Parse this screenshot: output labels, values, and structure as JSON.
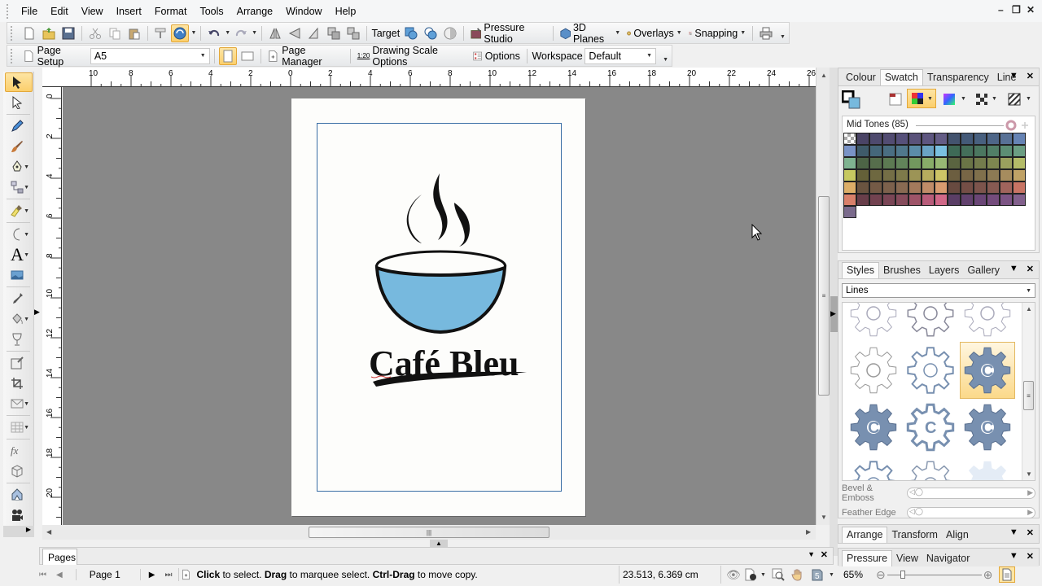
{
  "menubar": {
    "items": [
      "File",
      "Edit",
      "View",
      "Insert",
      "Format",
      "Tools",
      "Arrange",
      "Window",
      "Help"
    ],
    "window_controls": {
      "minimize": "–",
      "restore": "❐",
      "close": "✕"
    }
  },
  "toolbar1": {
    "target_label": "Target",
    "pressure_studio_label": "Pressure Studio",
    "planes_label": "3D Planes",
    "overlays_label": "Overlays",
    "snapping_label": "Snapping",
    "icons": [
      "new-icon",
      "open-icon",
      "save-icon",
      "cut-icon",
      "copy-icon",
      "paste-icon",
      "format-painter-icon",
      "globe-icon",
      "undo-icon",
      "redo-icon",
      "flip-horizontal-icon",
      "flip-vertical-icon",
      "rotate-icon",
      "group-icon",
      "ungroup-icon",
      "target-add-icon",
      "target-intersect-icon",
      "target-subtract-icon",
      "pressure-studio-icon",
      "3d-planes-icon",
      "overlays-icon",
      "snapping-icon",
      "print-icon"
    ]
  },
  "toolbar2": {
    "page_setup_label": "Page Setup",
    "page_size_value": "A5",
    "page_manager_label": "Page Manager",
    "drawing_scale_badge": "1:20",
    "drawing_scale_label": "Drawing Scale Options",
    "options_label": "Options",
    "workspace_label": "Workspace",
    "workspace_value": "Default"
  },
  "rulers": {
    "unit": "cm",
    "horizontal_ticks": [
      "10",
      "8",
      "6",
      "4",
      "2",
      "0",
      "2",
      "4",
      "6",
      "8",
      "10",
      "12",
      "14",
      "16",
      "18",
      "20",
      "22",
      "24",
      "26"
    ],
    "vertical_ticks": [
      "0",
      "2",
      "4",
      "6",
      "8",
      "10",
      "12",
      "14",
      "16",
      "18",
      "20"
    ]
  },
  "document": {
    "logo_text": "Café Bleu",
    "bowl_color": "#77b9de"
  },
  "pages_panel": {
    "tab_label": "Pages"
  },
  "statusbar": {
    "page_label": "Page 1",
    "hint_bold_1": "Click",
    "hint_1": " to select. ",
    "hint_bold_2": "Drag",
    "hint_2": " to marquee select. ",
    "hint_bold_3": "Ctrl-Drag",
    "hint_3": " to move copy.",
    "coordinates": "23.513,  6.369 cm",
    "zoom_value": "65%",
    "zoom_fraction": 0.15
  },
  "colour_panel": {
    "tabs": [
      "Colour",
      "Swatch",
      "Transparency",
      "Line"
    ],
    "selected_tab": "Swatch",
    "palette_title": "Mid Tones (85)",
    "swatch_rows": [
      [
        "checker",
        "#4a4466",
        "#4e4a6e",
        "#524c72",
        "#56507a",
        "#5a527a",
        "#5e5680",
        "#645d86",
        "#43536e",
        "#445a78",
        "#48607f",
        "#4e6688",
        "#587196",
        "#6683b4"
      ],
      [
        "#7a93c6",
        "#3f5b6a",
        "#45677a",
        "#4a6e82",
        "#50788c",
        "#5b8ca8",
        "#6aa3c4",
        "#7ac0e0",
        "#3e6a56",
        "#446f5a",
        "#4b7760",
        "#517f67",
        "#5c8e74",
        "#6b9e83"
      ],
      [
        "#7fb390",
        "#4d6446",
        "#566e4c",
        "#5c7a52",
        "#62845a",
        "#72985e",
        "#88ac68",
        "#98b874",
        "#5a6440",
        "#6a7446",
        "#747c4c",
        "#7e8750",
        "#9aa05e",
        "#b4bc68"
      ],
      [
        "#c6c860",
        "#646038",
        "#6e6840",
        "#746e46",
        "#7e7a4a",
        "#9c9456",
        "#b6ac5e",
        "#cdc466",
        "#6c5e40",
        "#786646",
        "#80704c",
        "#8c7a54",
        "#a68c5e",
        "#c0a266"
      ],
      [
        "#dcae68",
        "#6a5440",
        "#745a46",
        "#7c614c",
        "#886a52",
        "#a47a5c",
        "#c08c68",
        "#d89c70",
        "#684a40",
        "#744e46",
        "#7c544c",
        "#865a52",
        "#a0645c",
        "#c87464"
      ],
      [
        "#d8806a",
        "#683e4a",
        "#724250",
        "#7a4656",
        "#864c5c",
        "#9e5468",
        "#b85c7a",
        "#d06888",
        "#5a3e66",
        "#62426e",
        "#6a4676",
        "#744c7c",
        "#7c5484",
        "#82608c"
      ],
      [
        "#7a6a8c"
      ]
    ]
  },
  "styles_panel": {
    "tabs": [
      "Styles",
      "Brushes",
      "Layers",
      "Gallery"
    ],
    "selected_tab": "Styles",
    "category_value": "Lines",
    "bevel_label": "Bevel & Emboss",
    "feather_label": "Feather Edge"
  },
  "arrange_panel": {
    "tabs": [
      "Arrange",
      "Transform",
      "Align"
    ],
    "selected_tab": "Arrange"
  },
  "pressure_panel": {
    "tabs": [
      "Pressure",
      "View",
      "Navigator"
    ],
    "selected_tab": "Pressure"
  },
  "toolbox": {
    "tools": [
      "pick-tool-icon",
      "node-edit-tool-icon",
      "pencil-tool-icon",
      "brush-tool-icon",
      "pen-tool-icon",
      "connector-tool-icon",
      "paint-tool-icon",
      "shape-tool-icon",
      "text-tool-icon",
      "image-tool-icon",
      "eyedropper-tool-icon",
      "fill-tool-icon",
      "transparency-tool-icon",
      "edit-tool-icon",
      "crop-tool-icon",
      "envelope-tool-icon",
      "table-tool-icon",
      "formula-tool-icon",
      "3d-tool-icon",
      "pressure-tool-icon",
      "camera-tool-icon"
    ]
  }
}
